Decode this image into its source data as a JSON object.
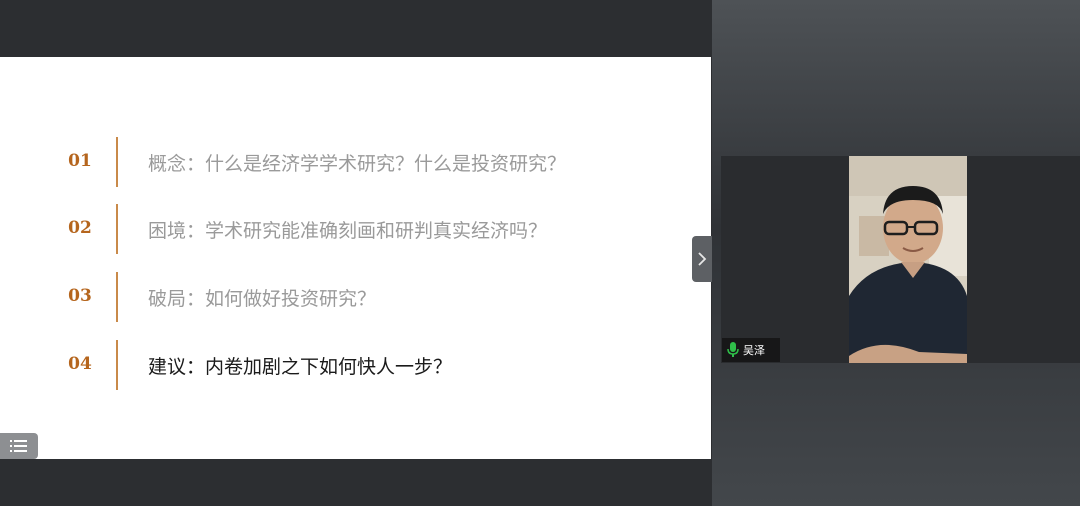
{
  "slide": {
    "agenda": [
      {
        "number": "01",
        "text": "概念：什么是经济学学术研究？什么是投资研究？",
        "active": false
      },
      {
        "number": "02",
        "text": "困境：学术研究能准确刻画和研判真实经济吗？",
        "active": false
      },
      {
        "number": "03",
        "text": "破局：如何做好投资研究？",
        "active": false
      },
      {
        "number": "04",
        "text": "建议：内卷加剧之下如何快人一步？",
        "active": true
      }
    ]
  },
  "video": {
    "participant_name": "吴泽",
    "mic_status": "active",
    "mic_color": "#2fbf4a"
  },
  "icons": {
    "list_button": "list-icon",
    "collapse_button": "chevron-right-icon",
    "mic": "microphone-icon"
  }
}
